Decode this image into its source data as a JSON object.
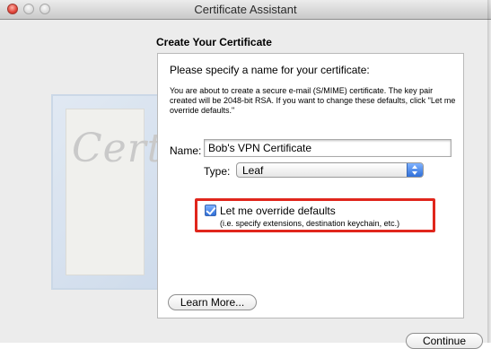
{
  "window": {
    "title": "Certificate Assistant"
  },
  "header": {
    "heading": "Create Your Certificate"
  },
  "main": {
    "prompt": "Please specify a name for your certificate:",
    "description": "You are about to create a secure e-mail (S/MIME) certificate. The key pair created will be 2048-bit RSA. If you want to change these defaults, click \"Let me override defaults.\"",
    "name_label": "Name:",
    "name_value": "Bob's VPN Certificate",
    "type_label": "Type:",
    "type_value": "Leaf",
    "override_checkbox": {
      "label": "Let me override defaults",
      "hint": "(i.e. specify extensions, destination keychain, etc.)",
      "checked": true
    },
    "learn_more_label": "Learn More..."
  },
  "footer": {
    "continue_label": "Continue"
  },
  "decor": {
    "certificate_watermark": "Certif"
  },
  "colors": {
    "highlight": "#e0261c",
    "accent": "#2f6fd8"
  },
  "icons": {
    "window_controls": [
      "close-icon",
      "minimize-icon",
      "zoom-icon"
    ],
    "select_arrows": "chevron-updown-icon",
    "checkbox_check": "checkmark-icon"
  }
}
